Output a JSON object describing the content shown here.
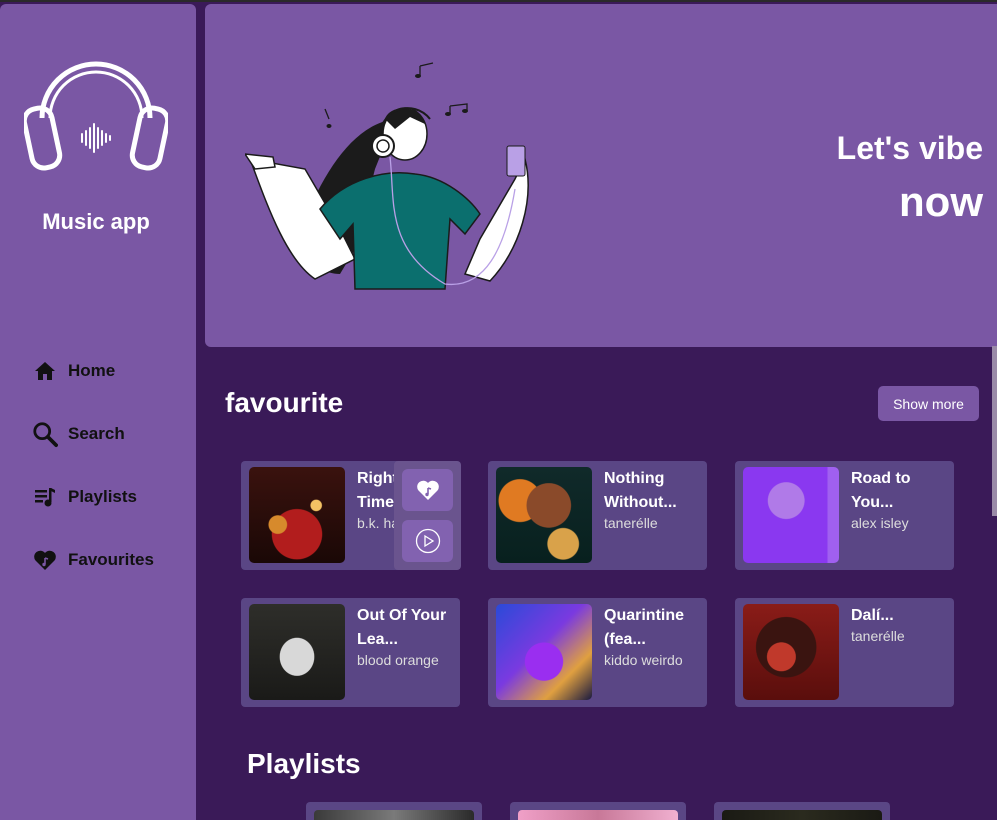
{
  "app": {
    "name": "Music app"
  },
  "nav": [
    {
      "label": "Home",
      "icon": "home-icon"
    },
    {
      "label": "Search",
      "icon": "search-icon"
    },
    {
      "label": "Playlists",
      "icon": "playlist-icon"
    },
    {
      "label": "Favourites",
      "icon": "heart-icon"
    }
  ],
  "hero": {
    "line1": "Let's vibe",
    "line2": "now"
  },
  "favourite": {
    "title": "favourite",
    "show_more": "Show more",
    "items": [
      {
        "title1": "Right o",
        "title2": "Time (",
        "artist": "b.k. ha"
      },
      {
        "title1": "Nothing",
        "title2": "Without...",
        "artist": "tanerélle"
      },
      {
        "title1": "Road to",
        "title2": "You...",
        "artist": "alex isley"
      },
      {
        "title1": "Out Of Your",
        "title2": "Lea...",
        "artist": "blood orange"
      },
      {
        "title1": "Quarintine",
        "title2": "(fea...",
        "artist": "kiddo weirdo"
      },
      {
        "title1": "Dalí...",
        "title2": "",
        "artist": "tanerélle"
      }
    ]
  },
  "playlists": {
    "title": "Playlists"
  },
  "colors": {
    "sidebar": "#7a57a4",
    "background": "#3a1a58",
    "card": "#5a4685",
    "accent": "#8262b0"
  }
}
